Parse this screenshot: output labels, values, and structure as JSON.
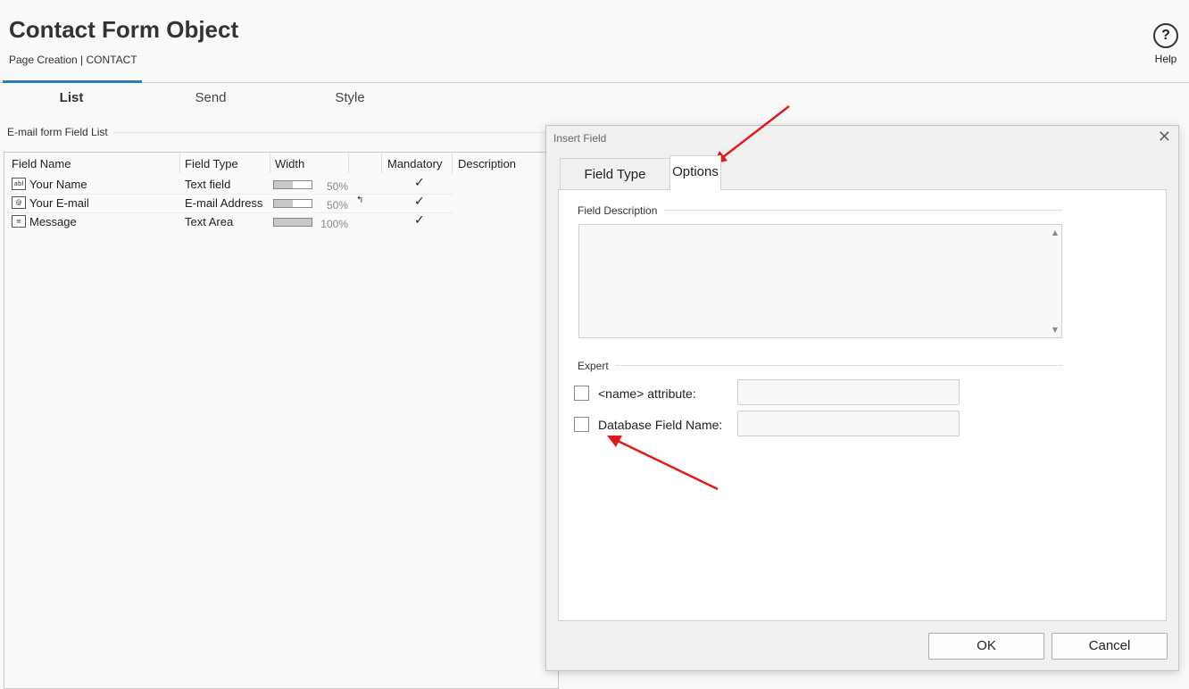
{
  "header": {
    "title": "Contact Form Object",
    "breadcrumb": "Page Creation | CONTACT",
    "help_label": "Help",
    "help_glyph": "?"
  },
  "main_tabs": [
    {
      "label": "List",
      "active": true
    },
    {
      "label": "Send",
      "active": false
    },
    {
      "label": "Style",
      "active": false
    }
  ],
  "field_list": {
    "group_label": "E-mail form Field List",
    "columns": [
      "Field Name",
      "Field Type",
      "Width",
      "Mandatory",
      "Description"
    ],
    "rows": [
      {
        "icon": "text-field-icon",
        "icon_glyph": "abl",
        "name": "Your Name",
        "type": "Text field",
        "width_pct": 50,
        "width_label": "50%",
        "mandatory": "✓"
      },
      {
        "icon": "email-field-icon",
        "icon_glyph": "@",
        "name": "Your E-mail",
        "type": "E-mail Address",
        "width_pct": 50,
        "width_label": "50%",
        "mandatory": "✓",
        "extra_glyph": "↰"
      },
      {
        "icon": "text-area-icon",
        "icon_glyph": "≡",
        "name": "Message",
        "type": "Text Area",
        "width_pct": 100,
        "width_label": "100%",
        "mandatory": "✓"
      }
    ]
  },
  "dialog": {
    "title": "Insert Field",
    "close_glyph": "✕",
    "tabs": [
      {
        "label": "Field Type",
        "active": false
      },
      {
        "label": "Options",
        "active": true
      }
    ],
    "field_description_label": "Field Description",
    "field_description_value": "",
    "expert_label": "Expert",
    "name_attr_label": "<name> attribute:",
    "name_attr_value": "",
    "db_field_label": "Database Field Name:",
    "db_field_value": "",
    "ok_label": "OK",
    "cancel_label": "Cancel"
  },
  "colors": {
    "accent": "#2b7cb4",
    "annotation_arrow": "#e01b1b"
  }
}
